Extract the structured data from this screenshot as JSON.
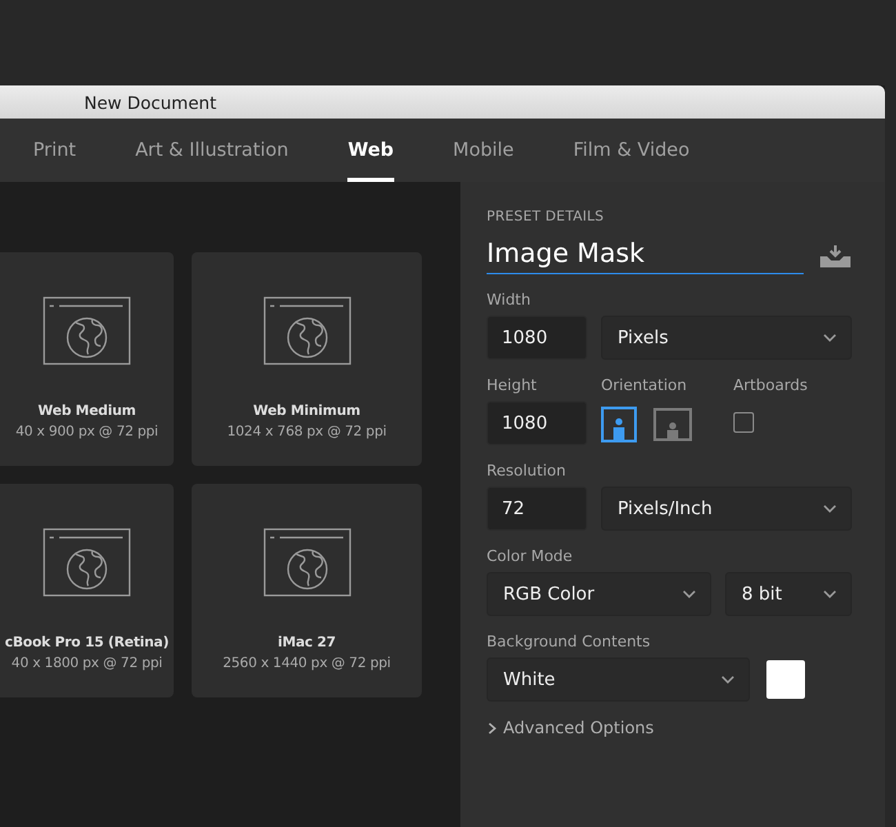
{
  "window": {
    "title": "New Document"
  },
  "tabs": [
    {
      "label": "Print",
      "selected": false
    },
    {
      "label": "Art & Illustration",
      "selected": false
    },
    {
      "label": "Web",
      "selected": true
    },
    {
      "label": "Mobile",
      "selected": false
    },
    {
      "label": "Film & Video",
      "selected": false
    }
  ],
  "presets": [
    {
      "name": "Web Medium",
      "size": "40 x 900 px @ 72 ppi"
    },
    {
      "name": "Web Minimum",
      "size": "1024 x 768 px @ 72 ppi"
    },
    {
      "name": "cBook Pro 15 (Retina)",
      "size": "40 x 1800 px @ 72 ppi"
    },
    {
      "name": "iMac 27",
      "size": "2560 x 1440 px @ 72 ppi"
    }
  ],
  "details": {
    "heading": "PRESET DETAILS",
    "name": "Image Mask",
    "width": {
      "label": "Width",
      "value": "1080",
      "unit": "Pixels"
    },
    "height": {
      "label": "Height",
      "value": "1080"
    },
    "orientation": {
      "label": "Orientation",
      "options": [
        {
          "kind": "portrait",
          "selected": true
        },
        {
          "kind": "landscape",
          "selected": false
        }
      ]
    },
    "artboards": {
      "label": "Artboards",
      "checked": false
    },
    "resolution": {
      "label": "Resolution",
      "value": "72",
      "unit": "Pixels/Inch"
    },
    "color_mode": {
      "label": "Color Mode",
      "mode": "RGB Color",
      "depth": "8 bit"
    },
    "background": {
      "label": "Background Contents",
      "value": "White",
      "color": "#ffffff"
    },
    "advanced": {
      "label": "Advanced Options",
      "expanded": false
    }
  }
}
